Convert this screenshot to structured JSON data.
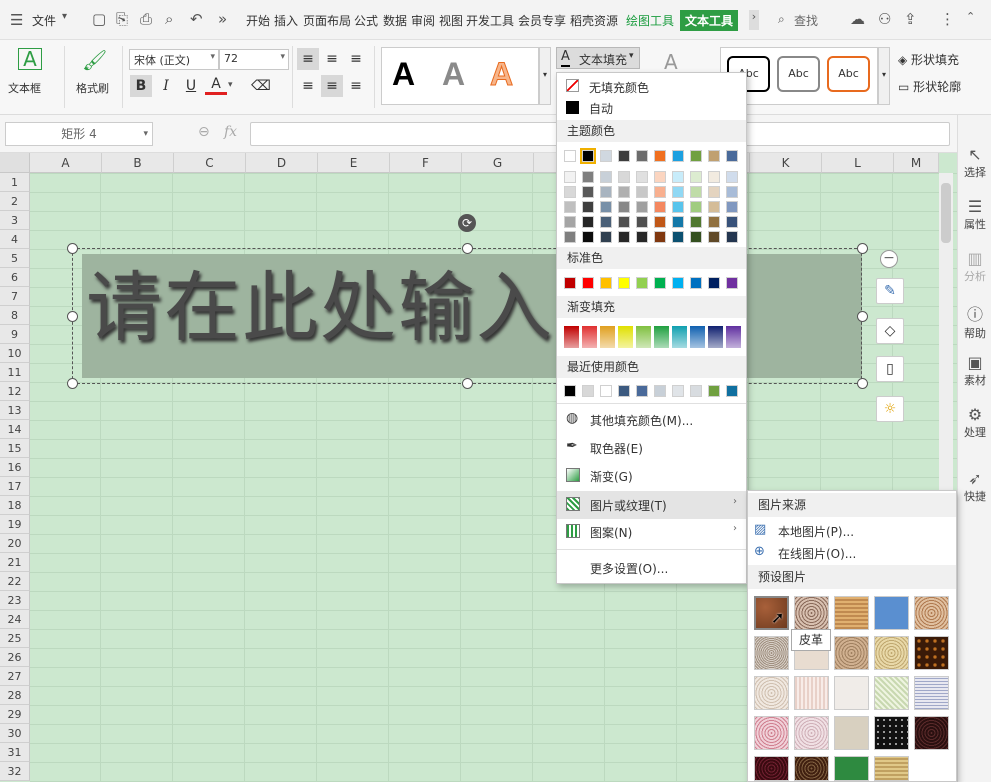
{
  "menubar": {
    "file_label": "文件",
    "tabs": [
      "开始",
      "插入",
      "页面布局",
      "公式",
      "数据",
      "审阅",
      "视图",
      "开发工具",
      "会员专享",
      "稻壳资源",
      "绘图工具",
      "文本工具"
    ],
    "search_label": "查找"
  },
  "ribbon": {
    "textbox_label": "文本框",
    "format_painter_label": "格式刷",
    "font_name": "宋体 (正文)",
    "font_size": "72",
    "text_fill_label": "文本填充",
    "shape_fill_label": "形状填充",
    "shape_outline_label": "形状轮廓",
    "style_sample": "Abc",
    "big_a": "A"
  },
  "formula": {
    "name_box": "矩形 4",
    "fx": "fx"
  },
  "sheet": {
    "columns": [
      "A",
      "B",
      "C",
      "D",
      "E",
      "F",
      "G",
      "H",
      "I",
      "J",
      "K",
      "L",
      "M"
    ],
    "rows": [
      "1",
      "2",
      "3",
      "4",
      "5",
      "6",
      "7",
      "8",
      "9",
      "10",
      "11",
      "12",
      "13",
      "14",
      "15",
      "16",
      "17",
      "18",
      "19",
      "20",
      "21",
      "22",
      "23",
      "24",
      "25",
      "26",
      "27",
      "28",
      "29",
      "30",
      "31",
      "32"
    ],
    "shape_text": "请在此处输入文字"
  },
  "sidebar": {
    "items": [
      "选择",
      "属性",
      "分析",
      "帮助",
      "素材",
      "处理",
      "快捷"
    ]
  },
  "dropdown": {
    "no_fill": "无填充颜色",
    "auto": "自动",
    "theme_colors": "主题颜色",
    "standard_colors": "标准色",
    "gradient_fill": "渐变填充",
    "recent_colors": "最近使用颜色",
    "more_colors": "其他填充颜色(M)...",
    "eyedropper": "取色器(E)",
    "gradient": "渐变(G)",
    "picture_texture": "图片或纹理(T)",
    "pattern": "图案(N)",
    "more_settings": "更多设置(O)..."
  },
  "submenu": {
    "picture_source": "图片来源",
    "local_picture": "本地图片(P)...",
    "online_picture": "在线图片(O)...",
    "preset_pictures": "预设图片",
    "tooltip": "皮革"
  },
  "colors": {
    "theme_top": [
      "#ffffff",
      "#000000",
      "#d0d8e0",
      "#3c3c3c",
      "#6c6c6c",
      "#f07020",
      "#1ca0e0",
      "#70a040",
      "#c0a070",
      "#4a6a9a"
    ],
    "standard": [
      "#c00000",
      "#ff0000",
      "#ffc000",
      "#ffff00",
      "#92d050",
      "#00b050",
      "#00b0f0",
      "#0070c0",
      "#002060",
      "#7030a0"
    ],
    "gradient": [
      "#c00000",
      "#e03030",
      "#e0a020",
      "#e0e000",
      "#80c040",
      "#20a040",
      "#10a0b0",
      "#1060b0",
      "#102070",
      "#6030a0"
    ],
    "recent": [
      "#000000",
      "#d8d8d8",
      "#ffffff",
      "#3c5a80",
      "#4a6a9a",
      "#c8d0d8",
      "#e0e4e8",
      "#d8dce0",
      "#70a040",
      "#1070a0"
    ]
  }
}
